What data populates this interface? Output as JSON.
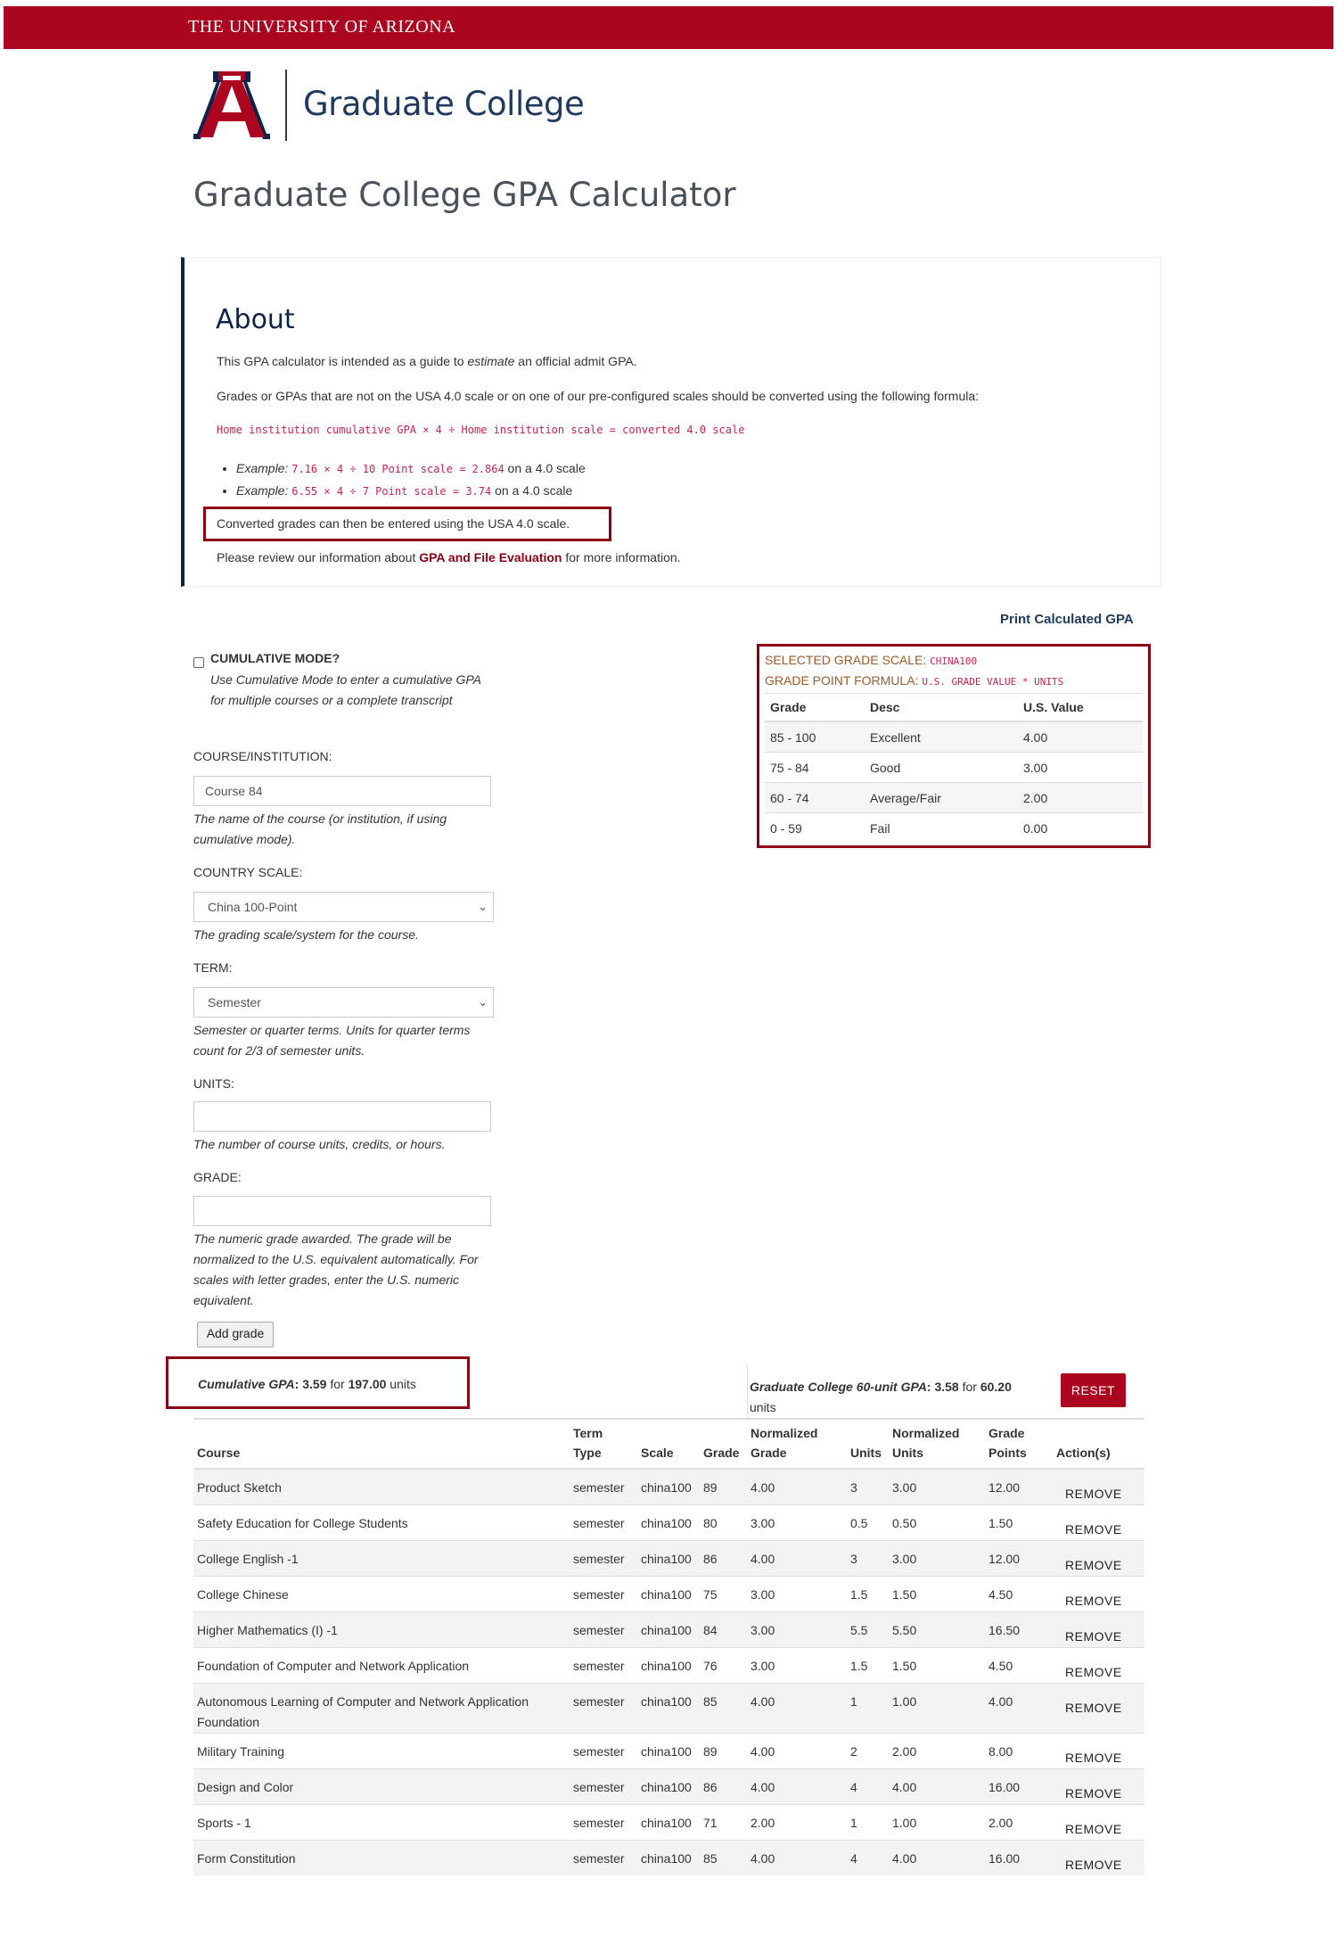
{
  "header": {
    "university": "The University of Arizona",
    "college": "Graduate College"
  },
  "page_title": "Graduate College GPA Calculator",
  "about": {
    "heading": "About",
    "intro_before": "This GPA calculator is intended as a guide to ",
    "intro_em": "estimate",
    "intro_after": " an official admit GPA.",
    "convert_text": "Grades or GPAs that are not on the USA 4.0 scale or on one of our pre-configured scales should be converted using the following formula:",
    "formula": "Home institution cumulative GPA × 4 ÷ Home institution scale = converted 4.0 scale",
    "examples": [
      {
        "label": "Example:",
        "formula": "7.16 × 4 ÷ 10 Point scale = 2.864",
        "suffix": " on a 4.0 scale"
      },
      {
        "label": "Example:",
        "formula": "6.55 × 4 ÷ 7 Point scale = 3.74",
        "suffix": " on a 4.0 scale"
      }
    ],
    "converted_note": "Converted grades can then be entered using the USA 4.0 scale.",
    "review_before": "Please review our information about ",
    "review_link": "GPA and File Evaluation",
    "review_after": " for more information."
  },
  "print_link": "Print Calculated GPA",
  "form": {
    "cumulative_label": "CUMULATIVE MODE?",
    "cumulative_help": "Use Cumulative Mode to enter a cumulative GPA for multiple courses or a complete transcript",
    "course_label": "COURSE/INSTITUTION:",
    "course_placeholder": "Course 84",
    "course_help": "The name of the course (or institution, if using cumulative mode).",
    "country_label": "COUNTRY SCALE:",
    "country_value": "China 100-Point",
    "country_help": "The grading scale/system for the course.",
    "term_label": "TERM:",
    "term_value": "Semester",
    "term_help": "Semester or quarter terms. Units for quarter terms count for 2/3 of semester units.",
    "units_label": "UNITS:",
    "units_value": "",
    "units_help": "The number of course units, credits, or hours.",
    "grade_label": "GRADE:",
    "grade_value": "",
    "grade_help": "The numeric grade awarded. The grade will be normalized to the U.S. equivalent automatically. For scales with letter grades, enter the U.S. numeric equivalent.",
    "add_button": "Add grade"
  },
  "scale": {
    "selected_label": "SELECTED GRADE SCALE: ",
    "selected_value": "CHINA100",
    "formula_label": "GRADE POINT FORMULA: ",
    "formula_value": "U.S. GRADE VALUE * UNITS",
    "headers": [
      "Grade",
      "Desc",
      "U.S. Value"
    ],
    "rows": [
      [
        "85 - 100",
        "Excellent",
        "4.00"
      ],
      [
        "75 - 84",
        "Good",
        "3.00"
      ],
      [
        "60 - 74",
        "Average/Fair",
        "2.00"
      ],
      [
        "0 - 59",
        "Fail",
        "0.00"
      ]
    ]
  },
  "summary": {
    "cum_label": "Cumulative GPA",
    "cum_value": "3.59",
    "cum_for": " for ",
    "cum_units": "197.00",
    "cum_units_word": " units",
    "grad_label": "Graduate College 60-unit GPA",
    "grad_value": "3.58",
    "grad_for": " for ",
    "grad_units": "60.20",
    "grad_units_word": "units",
    "reset": "RESET"
  },
  "table": {
    "headers": [
      "Course",
      "Term Type",
      "Scale",
      "Grade",
      "Normalized Grade",
      "Units",
      "Normalized Units",
      "Grade Points",
      "Action(s)"
    ],
    "remove_label": "REMOVE",
    "rows": [
      [
        "Product Sketch",
        "semester",
        "china100",
        "89",
        "4.00",
        "3",
        "3.00",
        "12.00"
      ],
      [
        "Safety Education for College Students",
        "semester",
        "china100",
        "80",
        "3.00",
        "0.5",
        "0.50",
        "1.50"
      ],
      [
        "College English -1",
        "semester",
        "china100",
        "86",
        "4.00",
        "3",
        "3.00",
        "12.00"
      ],
      [
        "College Chinese",
        "semester",
        "china100",
        "75",
        "3.00",
        "1.5",
        "1.50",
        "4.50"
      ],
      [
        "Higher Mathematics (I) -1",
        "semester",
        "china100",
        "84",
        "3.00",
        "5.5",
        "5.50",
        "16.50"
      ],
      [
        "Foundation of Computer and Network Application",
        "semester",
        "china100",
        "76",
        "3.00",
        "1.5",
        "1.50",
        "4.50"
      ],
      [
        "Autonomous Learning of Computer and Network Application Foundation",
        "semester",
        "china100",
        "85",
        "4.00",
        "1",
        "1.00",
        "4.00"
      ],
      [
        "Military Training",
        "semester",
        "china100",
        "89",
        "4.00",
        "2",
        "2.00",
        "8.00"
      ],
      [
        "Design and Color",
        "semester",
        "china100",
        "86",
        "4.00",
        "4",
        "4.00",
        "16.00"
      ],
      [
        "Sports - 1",
        "semester",
        "china100",
        "71",
        "2.00",
        "1",
        "1.00",
        "2.00"
      ],
      [
        "Form Constitution",
        "semester",
        "china100",
        "85",
        "4.00",
        "4",
        "4.00",
        "16.00"
      ]
    ]
  },
  "colors": {
    "brand_red": "#ab0520",
    "navy": "#0c234b",
    "highlight_box": "#8b0015"
  }
}
